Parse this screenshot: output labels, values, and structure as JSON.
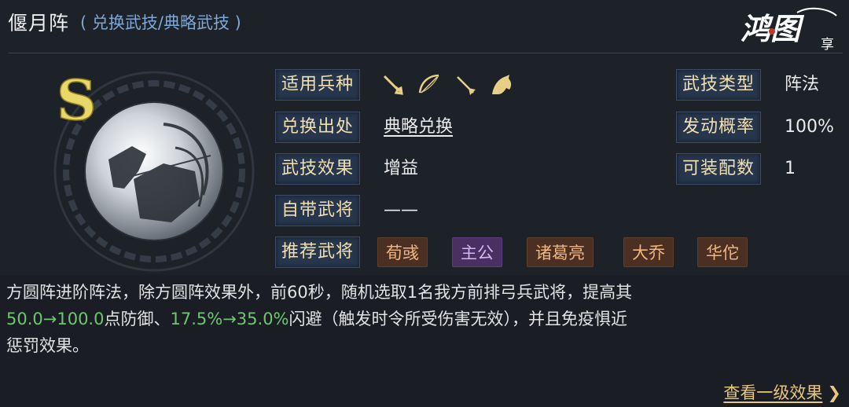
{
  "header": {
    "title": "偃月阵",
    "subtitle": "( 兑换武技/典略武技 )",
    "logo_text": "鸿图",
    "logo_sub": "享"
  },
  "emblem": {
    "grade": "S",
    "grade_color": "#e8d86a"
  },
  "info": {
    "troop_label": "适用兵种",
    "troop_icons": [
      "sword-icon",
      "bow-icon",
      "spear-icon",
      "horse-icon"
    ],
    "source_label": "兑换出处",
    "source_value": "典略兑换",
    "effect_label": "武技效果",
    "effect_value": "增益",
    "general_label": "自带武将",
    "general_value": "——",
    "recommend_label": "推荐武将",
    "recommend": [
      "荀彧",
      "主公",
      "诸葛亮",
      "大乔",
      "华佗"
    ],
    "type_label": "武技类型",
    "type_value": "阵法",
    "prob_label": "发动概率",
    "prob_value": "100%",
    "equip_label": "可装配数",
    "equip_value": "1"
  },
  "description": {
    "line1": "方圆阵进阶阵法，除方圆阵效果外，前60秒，随机选取1名我方前排弓兵武将，提高其",
    "defense": "50.0→100.0",
    "mid1": "点防御、",
    "dodge": "17.5%→35.0%",
    "mid2": "闪避（触发时令所受伤害无效），并且免疫惧近",
    "line3": "惩罚效果。"
  },
  "footer": {
    "more_label": "查看一级效果",
    "more_arrow": "❯"
  },
  "colors": {
    "label_bg": "#27364c",
    "label_text": "#f1e1b0",
    "green": "#6ec670",
    "tag_orange": "#efb682",
    "tag_purple": "#d3b6f2",
    "link": "#e7c67e"
  }
}
